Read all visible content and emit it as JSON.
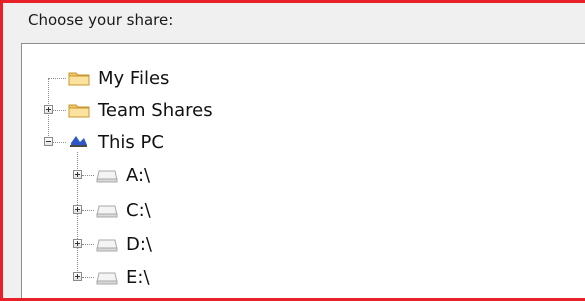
{
  "dialog": {
    "prompt": "Choose your share:"
  },
  "tree": {
    "items": [
      {
        "label": "My Files",
        "icon": "folder-icon",
        "expander": "none"
      },
      {
        "label": "Team Shares",
        "icon": "folder-icon",
        "expander": "plus"
      },
      {
        "label": "This PC",
        "icon": "computer-icon",
        "expander": "minus",
        "children": [
          {
            "label": "A:\\",
            "icon": "drive-icon",
            "expander": "plus"
          },
          {
            "label": "C:\\",
            "icon": "drive-icon",
            "expander": "plus"
          },
          {
            "label": "D:\\",
            "icon": "drive-icon",
            "expander": "plus"
          },
          {
            "label": "E:\\",
            "icon": "drive-icon",
            "expander": "plus"
          }
        ]
      }
    ]
  },
  "colors": {
    "highlight_border": "#e8202a",
    "folder": "#f2c66b",
    "pc_blue": "#2b57c7"
  }
}
